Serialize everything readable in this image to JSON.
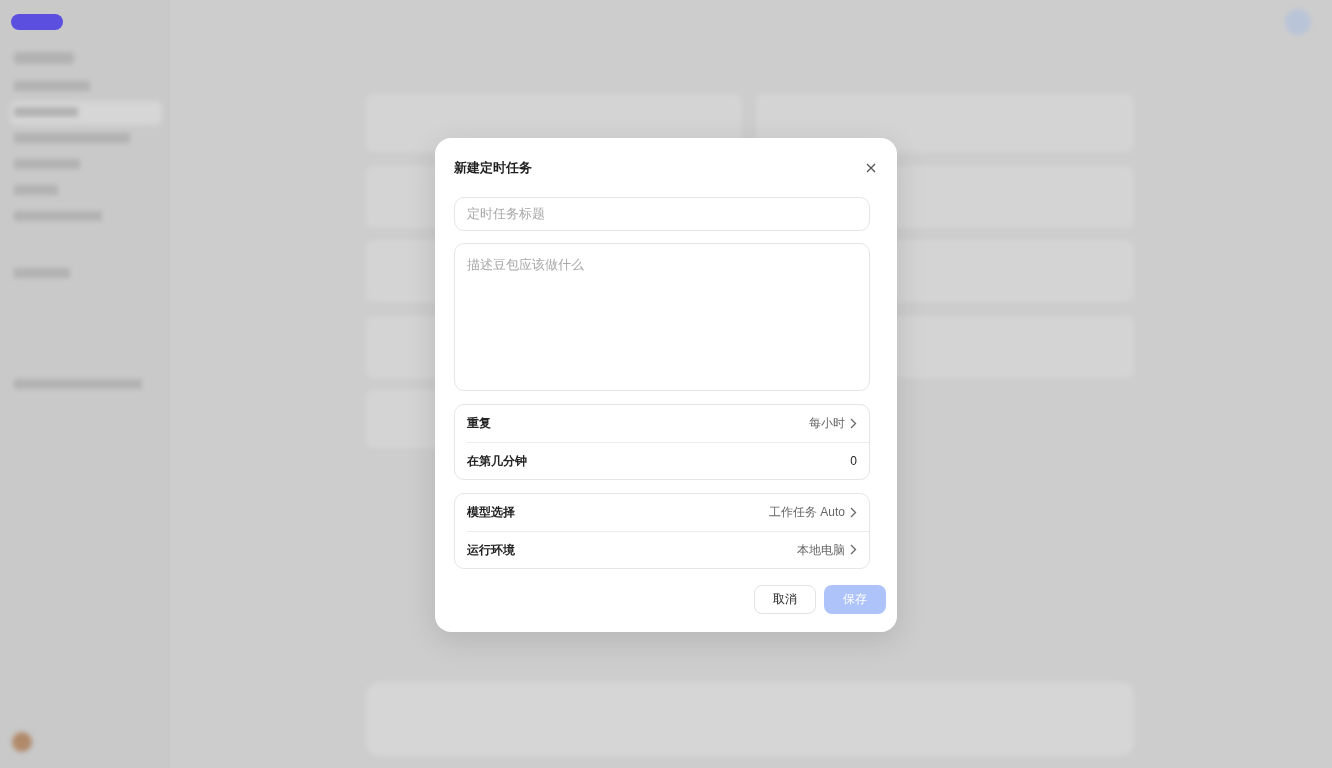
{
  "dialog": {
    "title": "新建定时任务",
    "title_field": {
      "placeholder": "定时任务标题"
    },
    "description_field": {
      "placeholder": "描述豆包应该做什么"
    },
    "groups": [
      {
        "rows": [
          {
            "kind": "select",
            "label": "重复",
            "value": "每小时"
          },
          {
            "kind": "number",
            "label": "在第几分钟",
            "value": "0"
          }
        ]
      },
      {
        "rows": [
          {
            "kind": "select",
            "label": "模型选择",
            "value": "工作任务 Auto"
          },
          {
            "kind": "select",
            "label": "运行环境",
            "value": "本地电脑"
          }
        ]
      }
    ],
    "buttons": [
      {
        "kind": "secondary",
        "label": "取消",
        "disabled": false
      },
      {
        "kind": "primary",
        "label": "保存",
        "disabled": true
      }
    ]
  }
}
